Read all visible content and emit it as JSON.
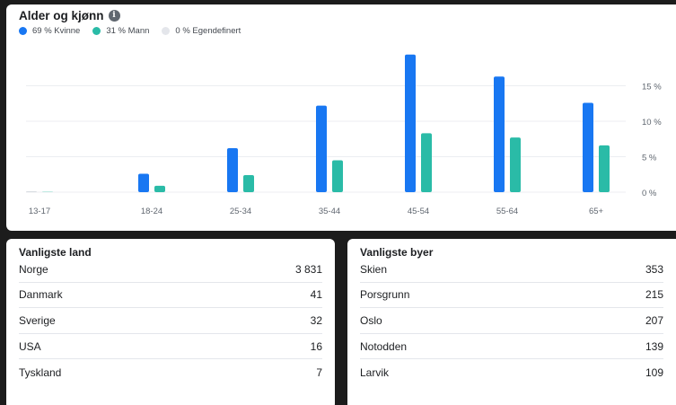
{
  "chart_card": {
    "title": "Alder og kjønn",
    "legend": [
      {
        "label": "69 % Kvinne",
        "color": "#1877f2"
      },
      {
        "label": "31 % Mann",
        "color": "#2abba7"
      },
      {
        "label": "0 % Egendefinert",
        "color": "#e4e6eb"
      }
    ]
  },
  "chart_data": {
    "type": "bar",
    "title": "Alder og kjønn",
    "categories": [
      "13-17",
      "18-24",
      "25-34",
      "35-44",
      "45-54",
      "55-64",
      "65+"
    ],
    "series": [
      {
        "name": "Kvinne",
        "color": "#1877f2",
        "values": [
          0.1,
          2.6,
          6.2,
          12.2,
          19.4,
          16.3,
          12.6
        ]
      },
      {
        "name": "Mann",
        "color": "#2abba7",
        "values": [
          0.1,
          0.9,
          2.4,
          4.5,
          8.3,
          7.7,
          6.6
        ]
      }
    ],
    "y_ticks": [
      0,
      5,
      10,
      15
    ],
    "y_tick_labels": [
      "0 %",
      "5 %",
      "10 %",
      "15 %"
    ],
    "ylim": [
      0,
      19.4
    ],
    "grid": true
  },
  "countries": {
    "title": "Vanligste land",
    "rows": [
      {
        "name": "Norge",
        "value": "3 831"
      },
      {
        "name": "Danmark",
        "value": "41"
      },
      {
        "name": "Sverige",
        "value": "32"
      },
      {
        "name": "USA",
        "value": "16"
      },
      {
        "name": "Tyskland",
        "value": "7"
      }
    ]
  },
  "cities": {
    "title": "Vanligste byer",
    "rows": [
      {
        "name": "Skien",
        "value": "353"
      },
      {
        "name": "Porsgrunn",
        "value": "215"
      },
      {
        "name": "Oslo",
        "value": "207"
      },
      {
        "name": "Notodden",
        "value": "139"
      },
      {
        "name": "Larvik",
        "value": "109"
      }
    ]
  }
}
